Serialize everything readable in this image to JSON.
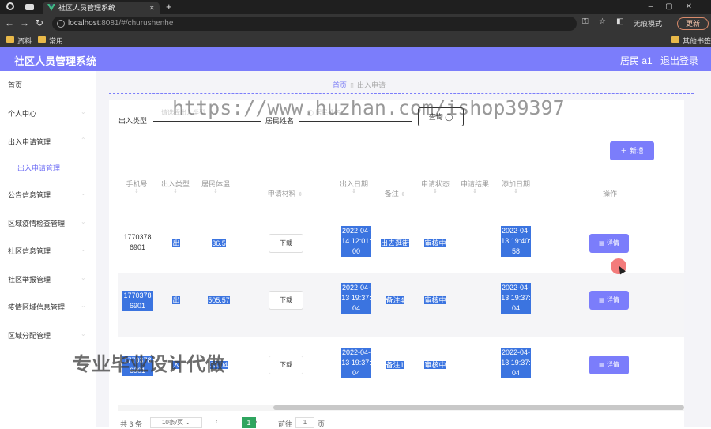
{
  "browser": {
    "tab_title": "社区人员管理系统",
    "url_host": "localhost",
    "url_rest": ":8081/#/churushenhe",
    "incognito": "无痕模式",
    "update": "更新",
    "bookmarks": [
      "资料",
      "常用"
    ],
    "other_bookmarks": "其他书签"
  },
  "header": {
    "title": "社区人员管理系统",
    "user": "居民 a1",
    "logout": "退出登录"
  },
  "sidebar": {
    "items": [
      "首页",
      "个人中心",
      "出入申请管理",
      "公告信息管理",
      "区域疫情检查管理",
      "社区信息管理",
      "社区举报管理",
      "疫情区域信息管理",
      "区域分配管理"
    ],
    "sub_item": "出入申请管理"
  },
  "breadcrumb": {
    "home": "首页",
    "current": "出入申请"
  },
  "search": {
    "type_label": "出入类型",
    "type_placeholder": "请选择出入类型",
    "name_label": "居民姓名",
    "name_placeholder": "居民姓名",
    "button": "查询"
  },
  "add_button": "新增",
  "table": {
    "headers": [
      "手机号",
      "出入类型",
      "居民体温",
      "申请材料",
      "出入日期",
      "备注",
      "申请状态",
      "申请结果",
      "添加日期",
      "操作"
    ],
    "rows": [
      {
        "phone": "17703786901",
        "type": "出",
        "temp": "36.5",
        "material": "下载",
        "date": "2022-04-14 12:01:00",
        "note": "出去逛街",
        "status": "审核中",
        "result": "",
        "added": "2022-04-13 19:40:58",
        "action": "详情"
      },
      {
        "phone": "17703786901",
        "type": "出",
        "temp": "505.57",
        "material": "下载",
        "date": "2022-04-13 19:37:04",
        "note": "备注4",
        "status": "审核中",
        "result": "",
        "added": "2022-04-13 19:37:04",
        "action": "详情"
      },
      {
        "phone": "17703786901",
        "type": "入",
        "temp": "33.04",
        "material": "下载",
        "date": "2022-04-13 19:37:04",
        "note": "备注1",
        "status": "审核中",
        "result": "",
        "added": "2022-04-13 19:37:04",
        "action": "详情"
      }
    ]
  },
  "pagination": {
    "total": "共 3 条",
    "page_size": "10条/页",
    "current": "1",
    "goto_label": "前往",
    "goto_value": "1",
    "page_unit": "页"
  },
  "watermarks": {
    "url": "https://www.huzhan.com/ishop39397",
    "text": "专业毕业设计代做"
  }
}
